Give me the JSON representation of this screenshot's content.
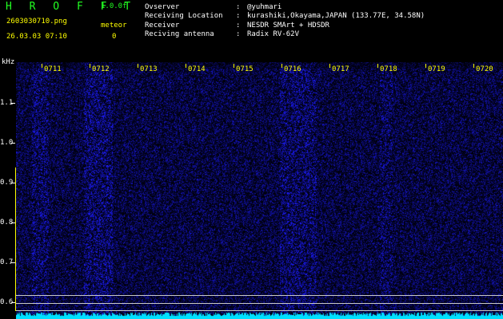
{
  "header": {
    "title": "H R O F F T",
    "version": "1.0.0f",
    "filename": "2603030710.png",
    "meteor_label": "meteor",
    "datetime": "26.03.03 07:10",
    "meteor_count": "0"
  },
  "station_info": [
    {
      "label": "Ovserver",
      "value": "@yuhmari"
    },
    {
      "label": "Receiving Location",
      "value": "kurashiki,Okayama,JAPAN (133.77E, 34.58N)"
    },
    {
      "label": "Receiver",
      "value": "NESDR SMArt + HDSDR"
    },
    {
      "label": "Reciving antenna",
      "value": "Radix RV-62V"
    }
  ],
  "spectrogram": {
    "unit_label": "kHz",
    "y_ticks": [
      "1.1",
      "1.0",
      "0.9",
      "0.8",
      "0.7",
      "0.6"
    ],
    "x_ticks": [
      "0711",
      "0712",
      "0713",
      "0714",
      "0715",
      "0716",
      "0717",
      "0718",
      "0719",
      "0720"
    ],
    "colors": {
      "background": "#000000",
      "noise": "#1a1aa0",
      "trace": "#00e0ff",
      "time_label": "#ffff00",
      "title": "#22ff22"
    }
  }
}
